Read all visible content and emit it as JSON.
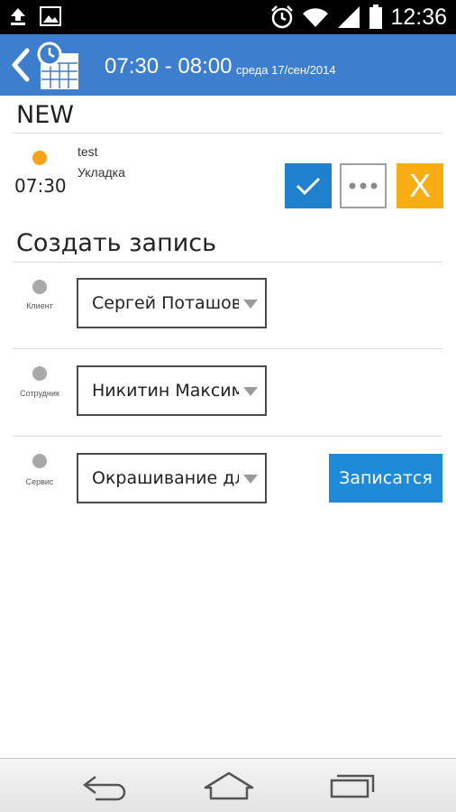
{
  "status_bar": {
    "time": "12:36",
    "icons": [
      "upload-icon",
      "image-icon",
      "alarm-icon",
      "wifi-icon",
      "signal-icon",
      "battery-icon"
    ]
  },
  "header": {
    "time_range": "07:30 - 08:00",
    "date": "среда 17/сен/2014",
    "accent_color": "#3d7fce",
    "icons": [
      "back-icon",
      "calendar-clock-icon"
    ]
  },
  "new_section": {
    "title": "NEW",
    "entry": {
      "time": "07:30",
      "client": "test",
      "service": "Укладка",
      "status_color": "#f5a31a",
      "actions": [
        {
          "name": "confirm",
          "icon": "check-icon",
          "color": "#1f80cd"
        },
        {
          "name": "more",
          "icon": "more-dots-icon",
          "color": "#ffffff"
        },
        {
          "name": "cancel",
          "label": "X",
          "color": "#f8ad13"
        }
      ]
    }
  },
  "create_section": {
    "title": "Создать запись",
    "fields": [
      {
        "label": "Клиент",
        "value": "Сергей Поташов"
      },
      {
        "label": "Сотрудник",
        "value": "Никитин Максим"
      },
      {
        "label": "Сервис",
        "value": "Окрашивание длинных волос"
      }
    ],
    "submit_label": "Записатся",
    "submit_color": "#1f8ad8"
  },
  "nav_bar": {
    "icons": [
      "back-arrow-icon",
      "home-icon",
      "recent-apps-icon"
    ]
  }
}
